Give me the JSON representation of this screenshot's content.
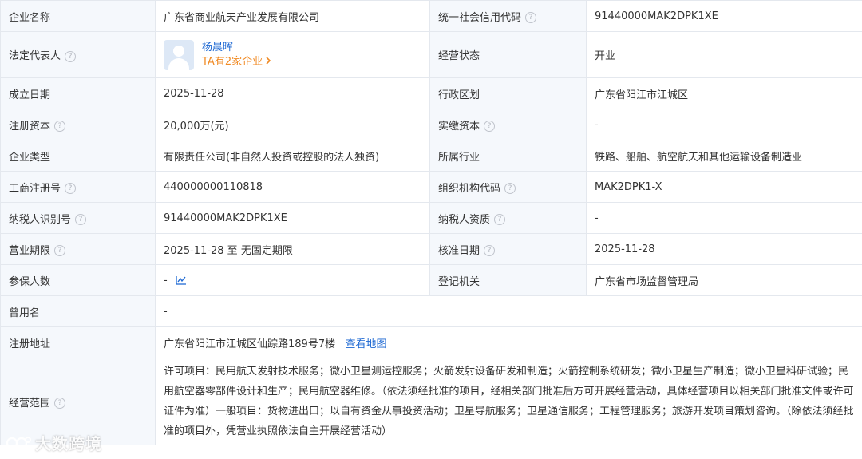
{
  "rows": [
    {
      "l1": "企业名称",
      "v1": "广东省商业航天产业发展有限公司",
      "l2": "统一社会信用代码",
      "v2": "91440000MAK2DPK1XE"
    },
    {
      "l1": "法定代表人",
      "l2": "经营状态",
      "v2": "开业"
    },
    {
      "l1": "成立日期",
      "v1": "2025-11-28",
      "l2": "行政区划",
      "v2": "广东省阳江市江城区"
    },
    {
      "l1": "注册资本",
      "v1": "20,000万(元)",
      "l2": "实缴资本",
      "v2": "-"
    },
    {
      "l1": "企业类型",
      "v1": "有限责任公司(非自然人投资或控股的法人独资)",
      "l2": "所属行业",
      "v2": "铁路、船舶、航空航天和其他运输设备制造业"
    },
    {
      "l1": "工商注册号",
      "v1": "440000000110818",
      "l2": "组织机构代码",
      "v2": "MAK2DPK1-X"
    },
    {
      "l1": "纳税人识别号",
      "v1": "91440000MAK2DPK1XE",
      "l2": "纳税人资质",
      "v2": "-"
    },
    {
      "l1": "营业期限",
      "v1": "2025-11-28 至 无固定期限",
      "l2": "核准日期",
      "v2": "2025-11-28"
    },
    {
      "l1": "参保人数",
      "v1": "-",
      "l2": "登记机关",
      "v2": "广东省市场监督管理局"
    },
    {
      "l1": "曾用名",
      "v1": "-"
    },
    {
      "l1": "注册地址",
      "v1": "广东省阳江市江城区仙踪路189号7楼",
      "link": "查看地图"
    },
    {
      "l1": "经营范围",
      "v1": "许可项目：民用航天发射技术服务；微小卫星测运控服务；火箭发射设备研发和制造；火箭控制系统研发；微小卫星生产制造；微小卫星科研试验；民用航空器零部件设计和生产；民用航空器维修。（依法须经批准的项目，经相关部门批准后方可开展经营活动，具体经营项目以相关部门批准文件或许可证件为准）一般项目：货物进出口；以自有资金从事投资活动；卫星导航服务；卫星通信服务；工程管理服务；旅游开发项目策划咨询。（除依法须经批准的项目外，凭营业执照依法自主开展经营活动）"
    }
  ],
  "legal_rep": {
    "name": "杨晨晖",
    "companies": "TA有2家企业"
  },
  "icons": {
    "help": "question-circle-icon",
    "trend": "trend-chart-icon",
    "chevron": "chevron-right-icon",
    "avatar": "user-avatar-icon"
  },
  "watermark": {
    "text": "大数跨境"
  },
  "colors": {
    "label_bg": "#f5f8fc",
    "border": "#e4e8ee",
    "link": "#1a66d2",
    "orange": "#f08a24"
  }
}
